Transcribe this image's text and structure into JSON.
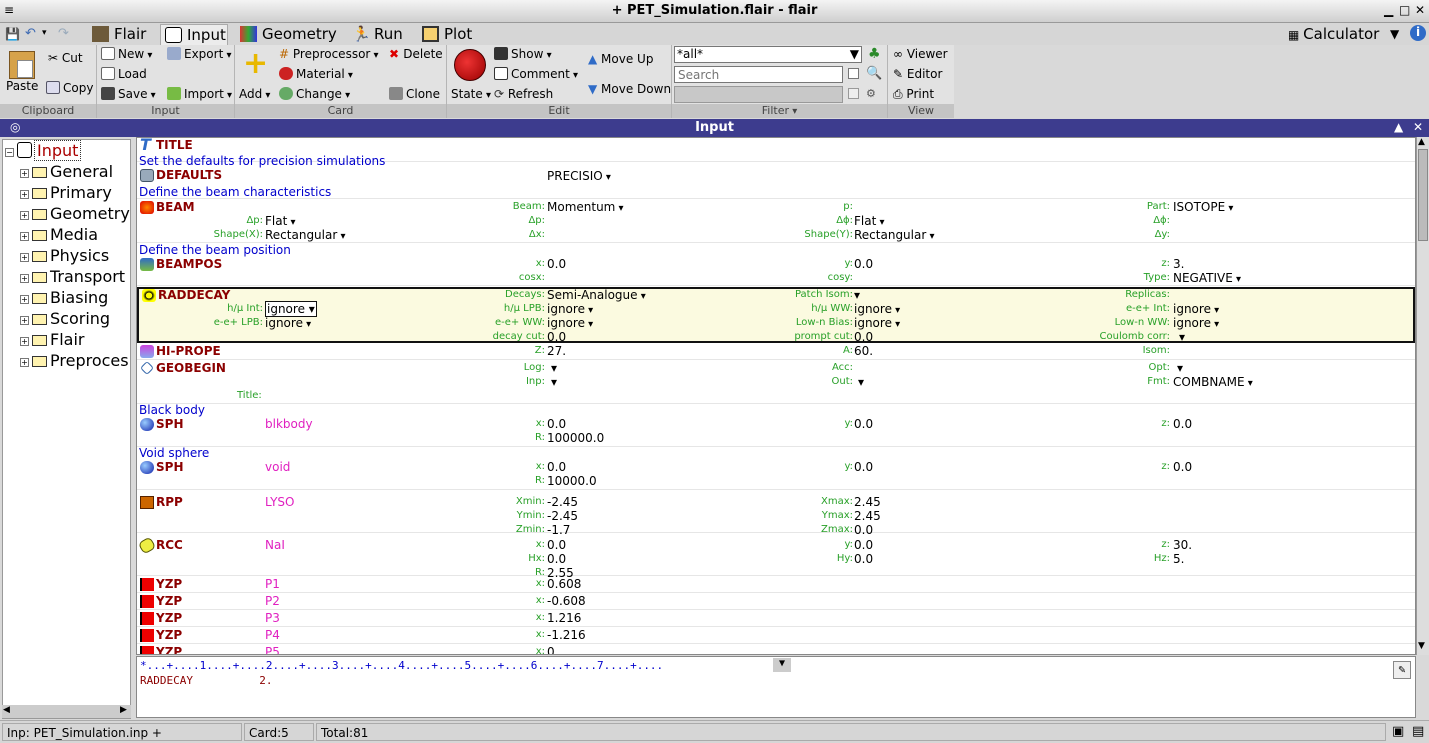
{
  "window": {
    "title": "+ PET_Simulation.flair - flair"
  },
  "tabs": [
    {
      "label": "Flair"
    },
    {
      "label": "Input"
    },
    {
      "label": "Geometry"
    },
    {
      "label": "Run"
    },
    {
      "label": "Plot"
    }
  ],
  "calculator": {
    "label": "Calculator"
  },
  "ribbon": {
    "clipboard": {
      "label": "Clipboard",
      "paste": "Paste",
      "cut": "Cut",
      "copy": "Copy"
    },
    "input": {
      "label": "Input",
      "new": "New",
      "load": "Load",
      "save": "Save",
      "export": "Export",
      "import": "Import"
    },
    "card": {
      "label": "Card",
      "add": "Add",
      "preprocessor": "Preprocessor",
      "material": "Material",
      "change": "Change",
      "delete": "Delete",
      "clone": "Clone"
    },
    "edit": {
      "label": "Edit",
      "state": "State",
      "show": "Show",
      "comment": "Comment",
      "refresh": "Refresh",
      "move_up": "Move Up",
      "move_down": "Move Down"
    },
    "filter": {
      "label": "Filter",
      "combo_value": "*all*",
      "search_placeholder": "Search"
    },
    "view": {
      "label": "View",
      "viewer": "Viewer",
      "editor": "Editor",
      "print": "Print"
    }
  },
  "panel": {
    "title": "Input"
  },
  "tree": {
    "root": "Input",
    "items": [
      "General",
      "Primary",
      "Geometry",
      "Media",
      "Physics",
      "Transport",
      "Biasing",
      "Scoring",
      "Flair",
      "Preproces"
    ]
  },
  "cards": {
    "title": {
      "name": "TITLE",
      "text": "Set the defaults for precision simulations"
    },
    "defaults": {
      "name": "DEFAULTS",
      "value": "PRECISIO",
      "comment": "Define the beam characteristics"
    },
    "beam": {
      "name": "BEAM",
      "beam_l": "Beam:",
      "beam": "Momentum",
      "p_l": "p:",
      "part_l": "Part:",
      "part": "ISOTOPE",
      "dp_l": "Δp:",
      "dp": "Flat",
      "dp2_l": "Δp:",
      "dphi_l": "Δϕ:",
      "dphi": "Flat",
      "dphi2_l": "Δϕ:",
      "shx_l": "Shape(X):",
      "shx": "Rectangular",
      "dx_l": "Δx:",
      "shy_l": "Shape(Y):",
      "shy": "Rectangular",
      "dy_l": "Δy:",
      "comment": "Define the beam position"
    },
    "beampos": {
      "name": "BEAMPOS",
      "x_l": "x:",
      "x": "0.0",
      "y_l": "y:",
      "y": "0.0",
      "z_l": "z:",
      "z": "3.",
      "cosx_l": "cosx:",
      "cosy_l": "cosy:",
      "type_l": "Type:",
      "type": "NEGATIVE"
    },
    "raddecay": {
      "name": "RADDECAY",
      "decays_l": "Decays:",
      "decays": "Semi-Analogue",
      "patch_l": "Patch Isom:",
      "replicas_l": "Replicas:",
      "hmint_l": "h/μ Int:",
      "hmint": "ignore",
      "hmlpb_l": "h/μ LPB:",
      "hmlpb": "ignore",
      "hmww_l": "h/μ WW:",
      "hmww": "ignore",
      "eeint_l": "e-e+ Int:",
      "eeint": "ignore",
      "eelpb_l": "e-e+ LPB:",
      "eelpb": "ignore",
      "eeww_l": "e-e+ WW:",
      "eeww": "ignore",
      "lownbias_l": "Low-n Bias:",
      "lownbias": "ignore",
      "lownww_l": "Low-n WW:",
      "lownww": "ignore",
      "decaycut_l": "decay cut:",
      "decaycut": "0.0",
      "promptcut_l": "prompt cut:",
      "promptcut": "0.0",
      "coulomb_l": "Coulomb corr:"
    },
    "hiprope": {
      "name": "HI-PROPE",
      "z_l": "Z:",
      "z": "27.",
      "a_l": "A:",
      "a": "60.",
      "isom_l": "Isom:"
    },
    "geobegin": {
      "name": "GEOBEGIN",
      "log_l": "Log:",
      "acc_l": "Acc:",
      "opt_l": "Opt:",
      "inp_l": "Inp:",
      "out_l": "Out:",
      "fmt_l": "Fmt:",
      "fmt": "COMBNAME",
      "title_l": "Title:"
    },
    "sph1": {
      "comment": "Black body",
      "name": "SPH",
      "body": "blkbody",
      "x": "0.0",
      "y": "0.0",
      "z": "0.0",
      "r": "100000.0"
    },
    "sph2": {
      "comment": "Void sphere",
      "name": "SPH",
      "body": "void",
      "x": "0.0",
      "y": "0.0",
      "z": "0.0",
      "r": "10000.0"
    },
    "rpp": {
      "name": "RPP",
      "body": "LYSO",
      "xmin_l": "Xmin:",
      "xmin": "-2.45",
      "xmax_l": "Xmax:",
      "xmax": "2.45",
      "ymin_l": "Ymin:",
      "ymin": "-2.45",
      "ymax_l": "Ymax:",
      "ymax": "2.45",
      "zmin_l": "Zmin:",
      "zmin": "-1.7",
      "zmax_l": "Zmax:",
      "zmax": "0.0"
    },
    "rcc": {
      "name": "RCC",
      "body": "NaI",
      "x": "0.0",
      "y": "0.0",
      "z": "30.",
      "hx_l": "Hx:",
      "hx": "0.0",
      "hy_l": "Hy:",
      "hy": "0.0",
      "hz_l": "Hz:",
      "hz": "5.",
      "r": "2.55"
    },
    "yzp": [
      {
        "name": "YZP",
        "body": "P1",
        "x": "0.608"
      },
      {
        "name": "YZP",
        "body": "P2",
        "x": "-0.608"
      },
      {
        "name": "YZP",
        "body": "P3",
        "x": "1.216"
      },
      {
        "name": "YZP",
        "body": "P4",
        "x": "-1.216"
      },
      {
        "name": "YZP",
        "body": "P5",
        "x": "0."
      }
    ],
    "lab": {
      "x": "x:",
      "y": "y:",
      "z": "z:",
      "r": "R:"
    }
  },
  "cmd": {
    "ruler": "*...+....1....+....2....+....3....+....4....+....5....+....6....+....7....+....",
    "line": "RADDECAY          2."
  },
  "status": {
    "file": "Inp: PET_Simulation.inp +",
    "card": "Card:5",
    "total": "Total:81"
  },
  "colors": {
    "header": "#3d3c8e",
    "card_name": "#8b0000",
    "field_label": "#28a028",
    "comment": "#0000cc",
    "body": "#e020c0"
  }
}
